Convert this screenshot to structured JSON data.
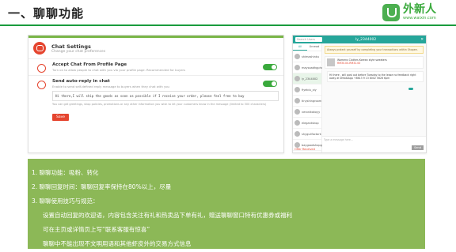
{
  "slide": {
    "title": "一、聊聊功能"
  },
  "logo": {
    "name": "外新人",
    "url": "www.waixin.com"
  },
  "settings": {
    "title": "Chat Settings",
    "subtitle": "Change your chat preferences",
    "items": [
      {
        "title": "Accept Chat From Profile Page",
        "desc": "Turn on to allow people to chat with you via your profile page. Recommended for buyers",
        "enabled": true
      },
      {
        "title": "Send auto-reply in chat",
        "desc": "Enable to send self-defined reply message to buyers when they chat with you",
        "enabled": true
      }
    ],
    "message": "Hi there,I will ship the goods as soon as possible if I receive your order, please feel free to buy",
    "note": "You can get greetings, shop policies, promotions or any other information you wish to let your customers know in the message (limited to 300 characters)",
    "save_label": "Save"
  },
  "chat": {
    "search_placeholder": "Search Users",
    "current_user": "ly_2344002",
    "close_icon": "close-icon",
    "tabs": [
      "All",
      "Unread"
    ],
    "contacts": [
      "shimashinku",
      "maysaadhgpha",
      "ly_2344002",
      "fiyeblu_xiy",
      "tinyshingroom",
      "veronikakoyy",
      "elegantshop",
      "shyguilfactork",
      "baygoodshopgb"
    ],
    "selected_contact": 2,
    "offer_label": "Offer Received",
    "notice": "Always protect yourself by completing your transactions within Shopee.",
    "product_name": "Womens Clothes Korean style sweaters",
    "product_price": "RM30.00-RM32.00",
    "message": "Hi there , will post out before Tuesday to the lease no feedback right away at WhatsApp +8613 9 13 8002 5626 6pm",
    "input_placeholder": "Type a message here...",
    "send_label": "Send"
  },
  "info": {
    "lines": [
      "1.   聊聊功能：吸粉、转化",
      "2.   聊聊回复时间：聊聊回复率保持在80%以上，尽量",
      "3.   聊聊使用技巧与规范：",
      "设置自动回复的欢迎语，内容包含关注有礼和热卖品下单有礼，赠送聊聊窗口特有优惠券或福利",
      "可在主页或详情页上写“联系客服有惊喜”",
      "聊聊中不能出现不文明用语和其他虾皮外的交易方式信息"
    ]
  },
  "colors": {
    "accent_green": "#1a9c3e",
    "panel_green": "#8cb857",
    "shopee_red": "#e5452f",
    "chat_teal": "#26a69a"
  }
}
